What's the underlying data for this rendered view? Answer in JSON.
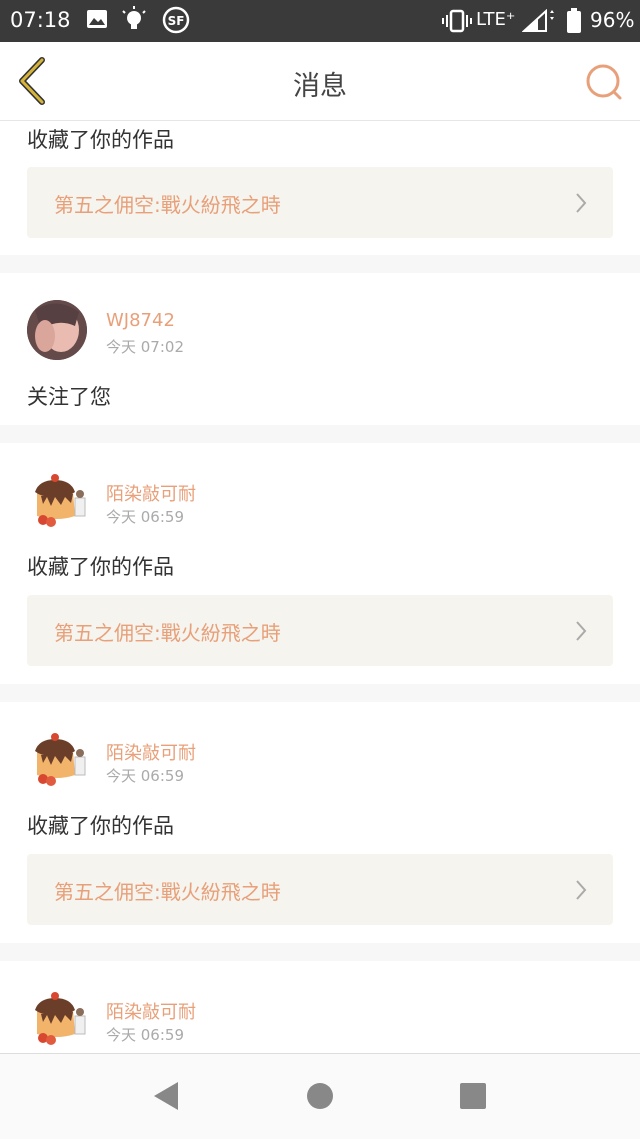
{
  "status_bar": {
    "time": "07:18",
    "network": "LTE⁺",
    "battery": "96%",
    "icons": [
      "image-icon",
      "lightbulb-icon",
      "sf-app-icon",
      "vibrate-icon",
      "signal-icon",
      "battery-icon"
    ]
  },
  "header": {
    "title": "消息",
    "back_icon": "chevron-left-icon",
    "search_icon": "search-icon",
    "accent_color": "#e8a07a",
    "back_color": "#d6b43a"
  },
  "messages": [
    {
      "action": "收藏了你的作品",
      "work_title": "第五之佣空:戰火紛飛之時"
    },
    {
      "username": "WJ8742",
      "time": "今天 07:02",
      "action": "关注了您"
    },
    {
      "username": "陌染敲可耐",
      "time": "今天 06:59",
      "action": "收藏了你的作品",
      "work_title": "第五之佣空:戰火紛飛之時"
    },
    {
      "username": "陌染敲可耐",
      "time": "今天 06:59",
      "action": "收藏了你的作品",
      "work_title": "第五之佣空:戰火紛飛之時"
    },
    {
      "username": "陌染敲可耐",
      "time": "今天 06:59"
    }
  ],
  "nav_bar": {
    "icons": [
      "back-triangle-icon",
      "home-circle-icon",
      "recents-square-icon"
    ]
  }
}
